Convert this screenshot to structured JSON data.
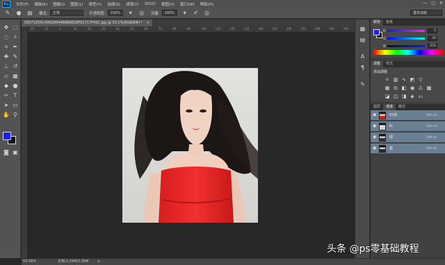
{
  "app": {
    "logo": "Ps"
  },
  "menubar": {
    "items": [
      "文件(F)",
      "编辑(E)",
      "图像(I)",
      "图层(L)",
      "类型(Y)",
      "选择(S)",
      "滤镜(T)",
      "3D(D)",
      "视图(V)",
      "窗口(W)",
      "帮助(H)"
    ],
    "window_buttons": [
      "—",
      "□",
      "✕"
    ]
  },
  "options": {
    "mode_label": "模式:",
    "mode_value": "正常",
    "opacity_label": "不透明度:",
    "opacity_value": "100%",
    "flow_label": "流量:",
    "flow_value": "100%",
    "workspace": "基本功能"
  },
  "document": {
    "tab_title": "56073255C49928044888AECBF61717F43C.jpg @ 53.1%(RGB/8#) *",
    "close_glyph": "×",
    "ruler_ticks": [
      "20",
      "10",
      "0",
      "10",
      "20",
      "30",
      "40",
      "50",
      "60",
      "70",
      "80",
      "90",
      "100",
      "110",
      "120",
      "130",
      "140",
      "150",
      "160",
      "170",
      "180",
      "190",
      "200"
    ]
  },
  "status": {
    "zoom": "53.06%",
    "doc_info": "文档:2.25M/2.25M"
  },
  "color_panel": {
    "tabs": [
      "颜色",
      "色板"
    ],
    "r_label": "R",
    "r_value": "0",
    "g_label": "G",
    "g_value": "30",
    "b_label": "B",
    "b_value": "255",
    "fg_color": "#1e1eff"
  },
  "adjust_panel": {
    "tabs": [
      "调整",
      "样式"
    ],
    "title": "添加调整"
  },
  "channels_panel": {
    "tabs": [
      "图层",
      "通道",
      "路径"
    ],
    "rows": [
      {
        "name": "RGB",
        "shortcut": "Ctrl+2"
      },
      {
        "name": "红",
        "shortcut": "Ctrl+3"
      },
      {
        "name": "绿",
        "shortcut": "Ctrl+4"
      },
      {
        "name": "蓝",
        "shortcut": "Ctrl+5"
      }
    ]
  },
  "watermark": {
    "text": "头条 @ps零基础教程"
  }
}
